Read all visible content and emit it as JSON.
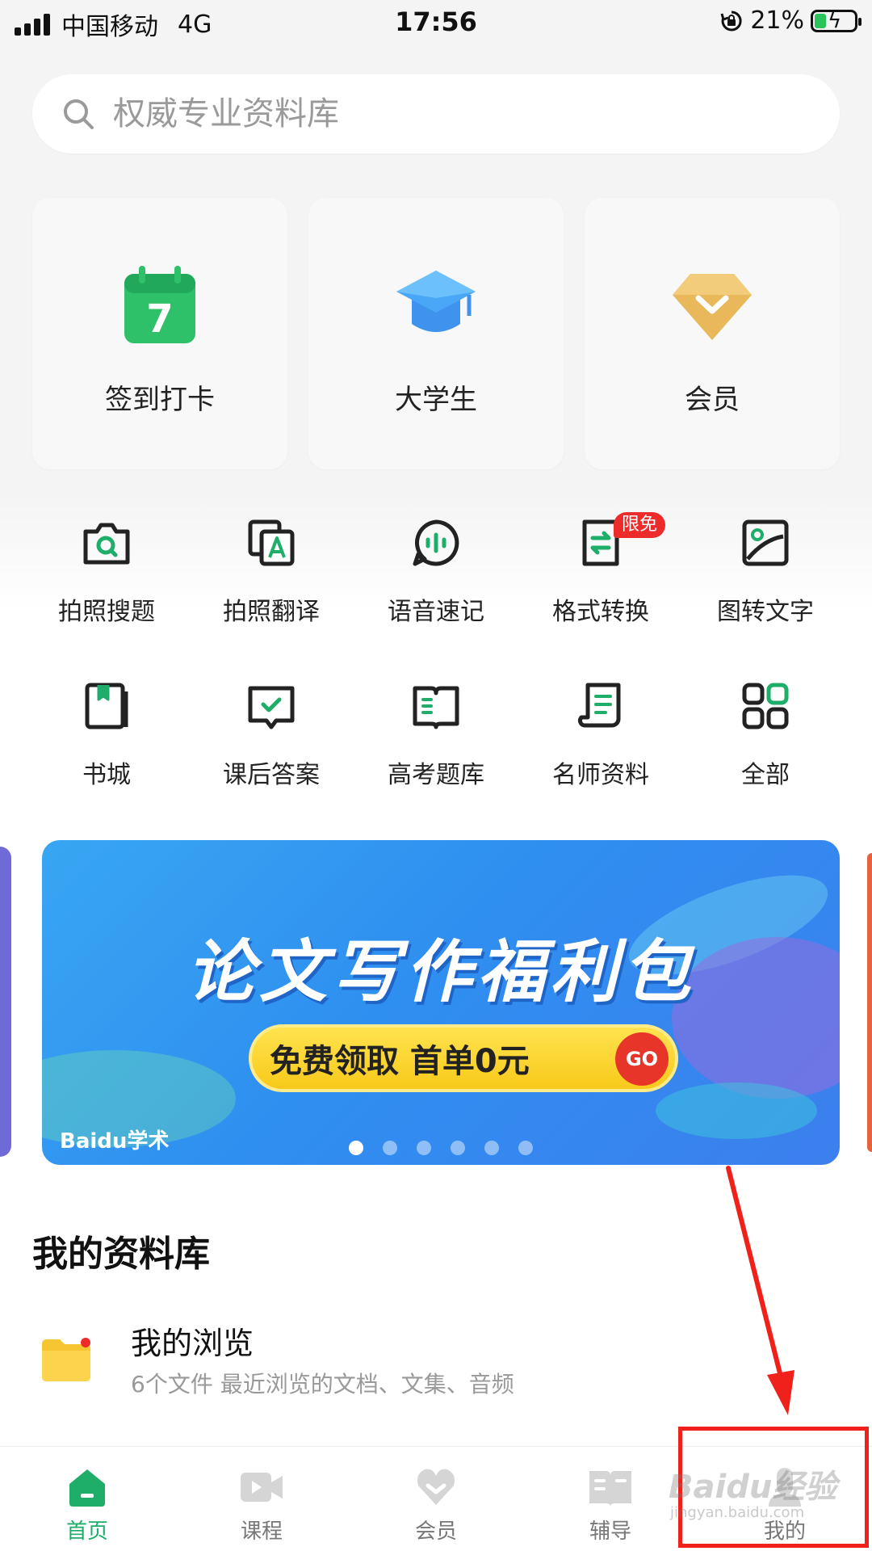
{
  "status_bar": {
    "carrier": "中国移动",
    "network": "4G",
    "time": "17:56",
    "battery": "21%"
  },
  "search": {
    "placeholder": "权威专业资料库"
  },
  "cards": [
    {
      "label": "签到打卡",
      "icon": "calendar-icon"
    },
    {
      "label": "大学生",
      "icon": "graduation-cap-icon"
    },
    {
      "label": "会员",
      "icon": "vip-diamond-icon"
    }
  ],
  "tools": [
    {
      "label": "拍照搜题",
      "icon": "camera-search-icon"
    },
    {
      "label": "拍照翻译",
      "icon": "photo-translate-icon"
    },
    {
      "label": "语音速记",
      "icon": "voice-memo-icon"
    },
    {
      "label": "格式转换",
      "icon": "format-convert-icon",
      "badge": "限免"
    },
    {
      "label": "图转文字",
      "icon": "image-to-text-icon"
    },
    {
      "label": "书城",
      "icon": "bookstore-icon"
    },
    {
      "label": "课后答案",
      "icon": "homework-answers-icon"
    },
    {
      "label": "高考题库",
      "icon": "exam-bank-icon"
    },
    {
      "label": "名师资料",
      "icon": "teacher-materials-icon"
    },
    {
      "label": "全部",
      "icon": "all-apps-icon"
    }
  ],
  "banner": {
    "title": "论文写作福利包",
    "button_text": "免费领取 首单0元",
    "go": "GO",
    "logo": "Baidu学术",
    "page_count": 6,
    "active_page": 1
  },
  "library": {
    "title": "我的资料库",
    "items": [
      {
        "name": "我的浏览",
        "description": "6个文件 最近浏览的文档、文集、音频"
      }
    ]
  },
  "bottom_nav": [
    {
      "label": "首页",
      "icon": "home-icon",
      "active": true
    },
    {
      "label": "课程",
      "icon": "video-icon",
      "active": false
    },
    {
      "label": "会员",
      "icon": "vip-heart-icon",
      "active": false
    },
    {
      "label": "辅导",
      "icon": "book-icon",
      "active": false
    },
    {
      "label": "我的",
      "icon": "profile-icon",
      "active": false
    }
  ],
  "colors": {
    "accent": "#1fae6a",
    "annotation": "#f0201a",
    "badge": "#ee2b2b",
    "banner": "#2f8ff0"
  }
}
